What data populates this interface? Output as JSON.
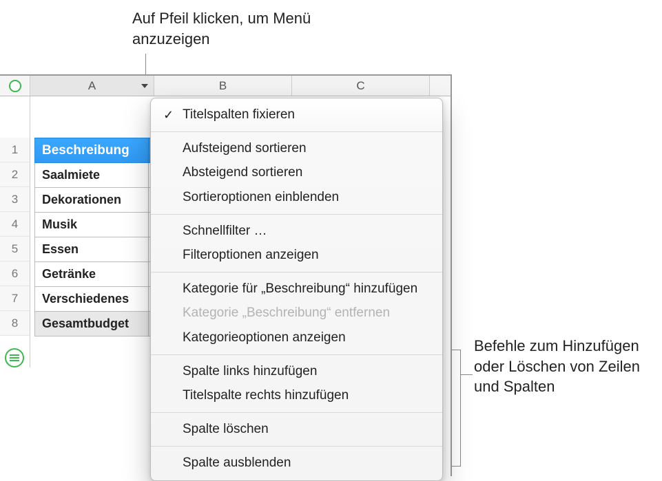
{
  "annotations": {
    "top": "Auf Pfeil klicken, um Menü anzuzeigen",
    "right": "Befehle zum Hinzufügen oder Löschen von Zeilen und Spalten"
  },
  "columns": {
    "A": "A",
    "B": "B",
    "C": "C"
  },
  "row_numbers": [
    "1",
    "2",
    "3",
    "4",
    "5",
    "6",
    "7",
    "8"
  ],
  "table": {
    "header": "Beschreibung",
    "rows": [
      "Saalmiete",
      "Dekorationen",
      "Musik",
      "Essen",
      "Getränke",
      "Verschiedenes"
    ],
    "total": "Gesamtbudget"
  },
  "menu": {
    "items": [
      {
        "label": "Titelspalten fixieren",
        "checked": true
      },
      "---",
      {
        "label": "Aufsteigend sortieren"
      },
      {
        "label": "Absteigend sortieren"
      },
      {
        "label": "Sortieroptionen einblenden"
      },
      "---",
      {
        "label": "Schnellfilter …"
      },
      {
        "label": "Filteroptionen anzeigen"
      },
      "---",
      {
        "label": "Kategorie für „Beschreibung“ hinzufügen"
      },
      {
        "label": "Kategorie „Beschreibung“ entfernen",
        "disabled": true
      },
      {
        "label": "Kategorieoptionen anzeigen"
      },
      "---",
      {
        "label": "Spalte links hinzufügen"
      },
      {
        "label": "Titelspalte rechts hinzufügen"
      },
      "---",
      {
        "label": "Spalte löschen"
      },
      "---",
      {
        "label": "Spalte ausblenden"
      }
    ]
  }
}
